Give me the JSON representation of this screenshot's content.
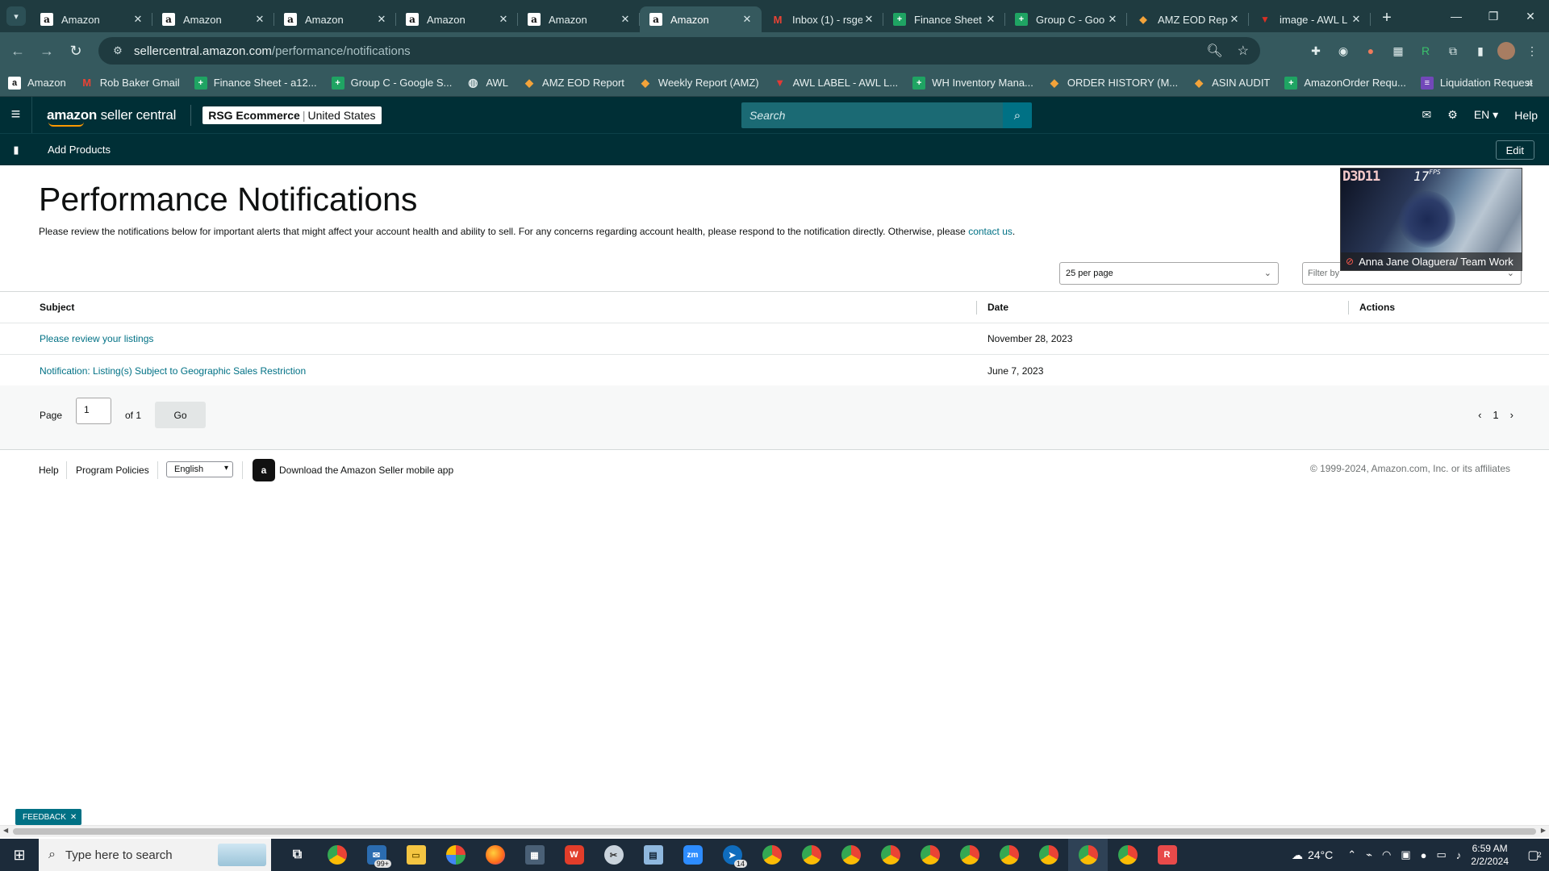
{
  "browser": {
    "tabs": [
      {
        "title": "Amazon",
        "icon": "amazon-icon",
        "active": false
      },
      {
        "title": "Amazon",
        "icon": "amazon-icon",
        "active": false
      },
      {
        "title": "Amazon",
        "icon": "amazon-icon",
        "active": false
      },
      {
        "title": "Amazon",
        "icon": "amazon-icon",
        "active": false
      },
      {
        "title": "Amazon",
        "icon": "amazon-icon",
        "active": false
      },
      {
        "title": "Amazon",
        "icon": "amazon-icon",
        "active": true
      },
      {
        "title": "Inbox (1) - rsge",
        "icon": "gmail-icon",
        "active": false
      },
      {
        "title": "Finance Sheet",
        "icon": "sheets-icon",
        "active": false
      },
      {
        "title": "Group C - Goo",
        "icon": "sheets-icon",
        "active": false
      },
      {
        "title": "AMZ EOD Rep",
        "icon": "eod-icon",
        "active": false
      },
      {
        "title": "image - AWL L",
        "icon": "awl-icon",
        "active": false
      }
    ],
    "url_host": "sellercentral.amazon.com",
    "url_path": "/performance/notifications",
    "bookmarks": [
      {
        "label": "Amazon",
        "icon": "amazon-icon"
      },
      {
        "label": "Rob Baker Gmail",
        "icon": "gmail-icon"
      },
      {
        "label": "Finance Sheet - a12...",
        "icon": "sheets-icon"
      },
      {
        "label": "Group C - Google S...",
        "icon": "sheets-icon"
      },
      {
        "label": "AWL",
        "icon": "globe-icon"
      },
      {
        "label": "AMZ EOD Report",
        "icon": "eod-icon"
      },
      {
        "label": "Weekly Report (AMZ)",
        "icon": "eod-icon"
      },
      {
        "label": "AWL LABEL - AWL L...",
        "icon": "awl-icon"
      },
      {
        "label": "WH Inventory Mana...",
        "icon": "sheets-icon"
      },
      {
        "label": "ORDER HISTORY (M...",
        "icon": "eod-icon"
      },
      {
        "label": "ASIN AUDIT",
        "icon": "eod-icon"
      },
      {
        "label": "AmazonOrder Requ...",
        "icon": "sheets-icon"
      },
      {
        "label": "Liquidation Request",
        "icon": "forms-icon"
      }
    ]
  },
  "header": {
    "logo_bold": "amazon",
    "logo_rest": " seller central",
    "account_name": "RSG Ecommerce",
    "account_region": "United States",
    "search_placeholder": "Search",
    "language": "EN",
    "help": "Help"
  },
  "subnav": {
    "link": "Add Products",
    "edit": "Edit"
  },
  "page": {
    "title": "Performance Notifications",
    "description": "Please review the notifications below for important alerts that might affect your account health and ability to sell. For any concerns regarding account health, please respond to the notification directly. Otherwise, please ",
    "contact_link": "contact us",
    "description_end": ".",
    "per_page": "25 per page",
    "filter_placeholder": "Filter by"
  },
  "table": {
    "columns": [
      "Subject",
      "Date",
      "Actions"
    ],
    "rows": [
      {
        "subject": "Please review your listings",
        "date": "November 28, 2023"
      },
      {
        "subject": "Notification: Listing(s) Subject to Geographic Sales Restriction",
        "date": "June 7, 2023"
      }
    ]
  },
  "pagination": {
    "label": "Page",
    "value": "1",
    "of": "of 1",
    "go": "Go",
    "current": "1"
  },
  "footer": {
    "help": "Help",
    "policies": "Program Policies",
    "language": "English",
    "app": "Download the Amazon Seller mobile app",
    "copyright": "© 1999-2024, Amazon.com, Inc. or its affiliates"
  },
  "video": {
    "tag": "D3D11",
    "fps": "17",
    "fps_unit": "FPS",
    "participant": "Anna Jane Olaguera/ Team Work"
  },
  "feedback": "FEEDBACK",
  "taskbar": {
    "search_placeholder": "Type here to search",
    "mail_badge": "99+",
    "teams_badge": "14",
    "temperature": "24°C",
    "time": "6:59 AM",
    "date": "2/2/2024",
    "notification_count": "2"
  },
  "colors": {
    "header_bg": "#002f36",
    "link": "#007185",
    "accent": "#ff9900"
  }
}
